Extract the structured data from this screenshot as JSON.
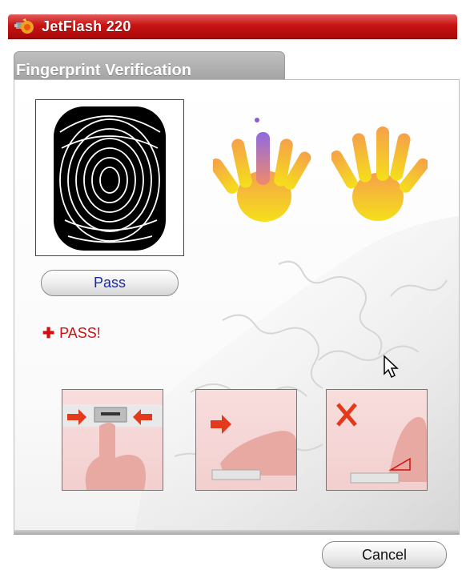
{
  "window": {
    "title": "JetFlash 220",
    "icon": "app-icon"
  },
  "tab": {
    "label": "Fingerprint Verification"
  },
  "verify_button": {
    "label": "Pass"
  },
  "status": {
    "icon": "plus-icon",
    "text": "PASS!",
    "color": "#d01010"
  },
  "instructions": [
    {
      "name": "instruction-press",
      "icon": "press-finger-icon"
    },
    {
      "name": "instruction-swipe",
      "icon": "swipe-finger-icon"
    },
    {
      "name": "instruction-wrong",
      "icon": "wrong-angle-icon"
    }
  ],
  "footer": {
    "cancel_label": "Cancel"
  },
  "colors": {
    "titlebar": "#c81414",
    "accent": "#d01010",
    "button_text": "#1a2a9a",
    "hand_top": "#f5a04a",
    "hand_bottom": "#f5e01a",
    "selected_finger": "#9a6ad8"
  }
}
